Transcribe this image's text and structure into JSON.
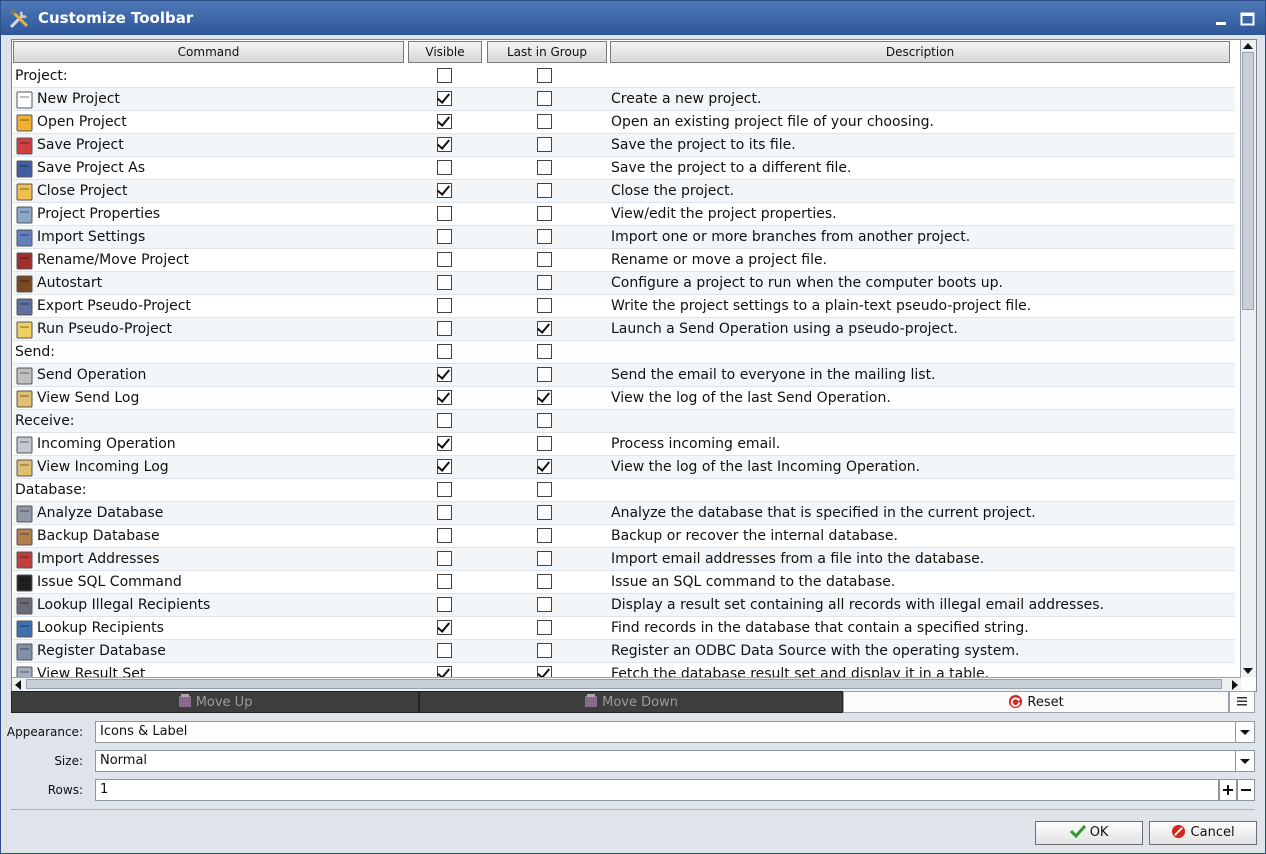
{
  "window": {
    "title": "Customize Toolbar"
  },
  "columns": {
    "command": "Command",
    "visible": "Visible",
    "last_in_group": "Last in Group",
    "description": "Description"
  },
  "rows": [
    {
      "type": "group",
      "label": "Project:",
      "visible": false,
      "last": false,
      "desc": ""
    },
    {
      "type": "item",
      "icon": "new-project-icon",
      "label": "New Project",
      "visible": true,
      "last": false,
      "desc": "Create a new project."
    },
    {
      "type": "item",
      "icon": "open-project-icon",
      "label": "Open Project",
      "visible": true,
      "last": false,
      "desc": "Open an existing project file of your choosing."
    },
    {
      "type": "item",
      "icon": "save-project-icon",
      "label": "Save Project",
      "visible": true,
      "last": false,
      "desc": "Save the project to its file."
    },
    {
      "type": "item",
      "icon": "save-project-as-icon",
      "label": "Save Project As",
      "visible": false,
      "last": false,
      "desc": "Save the project to a different file."
    },
    {
      "type": "item",
      "icon": "close-project-icon",
      "label": "Close Project",
      "visible": true,
      "last": false,
      "desc": "Close the project."
    },
    {
      "type": "item",
      "icon": "project-properties-icon",
      "label": "Project Properties",
      "visible": false,
      "last": false,
      "desc": "View/edit the project properties."
    },
    {
      "type": "item",
      "icon": "import-settings-icon",
      "label": "Import Settings",
      "visible": false,
      "last": false,
      "desc": "Import one or more branches from another project."
    },
    {
      "type": "item",
      "icon": "rename-move-project-icon",
      "label": "Rename/Move Project",
      "visible": false,
      "last": false,
      "desc": "Rename or move a project file."
    },
    {
      "type": "item",
      "icon": "autostart-boot-icon",
      "label": "Autostart",
      "visible": false,
      "last": false,
      "desc": "Configure a project to run when the computer boots up."
    },
    {
      "type": "item",
      "icon": "export-pseudo-project-icon",
      "label": "Export Pseudo-Project",
      "visible": false,
      "last": false,
      "desc": "Write the project settings to a plain-text pseudo-project file."
    },
    {
      "type": "item",
      "icon": "run-pseudo-project-icon",
      "label": "Run Pseudo-Project",
      "visible": false,
      "last": true,
      "desc": "Launch a Send Operation using a pseudo-project."
    },
    {
      "type": "group",
      "label": "Send:",
      "visible": false,
      "last": false,
      "desc": ""
    },
    {
      "type": "item",
      "icon": "send-operation-icon",
      "label": "Send Operation",
      "visible": true,
      "last": false,
      "desc": "Send the email to everyone in the mailing list."
    },
    {
      "type": "item",
      "icon": "view-send-log-icon",
      "label": "View Send Log",
      "visible": true,
      "last": true,
      "desc": "View the log of the last Send Operation."
    },
    {
      "type": "group",
      "label": "Receive:",
      "visible": false,
      "last": false,
      "desc": ""
    },
    {
      "type": "item",
      "icon": "incoming-operation-icon",
      "label": "Incoming Operation",
      "visible": true,
      "last": false,
      "desc": "Process incoming email."
    },
    {
      "type": "item",
      "icon": "view-incoming-log-icon",
      "label": "View Incoming Log",
      "visible": true,
      "last": true,
      "desc": "View the log of the last Incoming Operation."
    },
    {
      "type": "group",
      "label": "Database:",
      "visible": false,
      "last": false,
      "desc": ""
    },
    {
      "type": "item",
      "icon": "analyze-database-icon",
      "label": "Analyze Database",
      "visible": false,
      "last": false,
      "desc": "Analyze the database that is specified in the current project."
    },
    {
      "type": "item",
      "icon": "backup-database-icon",
      "label": "Backup Database",
      "visible": false,
      "last": false,
      "desc": "Backup or recover the internal database."
    },
    {
      "type": "item",
      "icon": "import-addresses-icon",
      "label": "Import Addresses",
      "visible": false,
      "last": false,
      "desc": "Import email addresses from a file into the database."
    },
    {
      "type": "item",
      "icon": "sql-command-icon",
      "label": "Issue SQL Command",
      "visible": false,
      "last": false,
      "desc": "Issue an SQL command to the database."
    },
    {
      "type": "item",
      "icon": "lookup-illegal-recipients-icon",
      "label": "Lookup Illegal Recipients",
      "visible": false,
      "last": false,
      "desc": "Display a result set containing all records with illegal email addresses."
    },
    {
      "type": "item",
      "icon": "lookup-recipients-icon",
      "label": "Lookup Recipients",
      "visible": true,
      "last": false,
      "desc": "Find records in the database that contain a specified string."
    },
    {
      "type": "item",
      "icon": "register-database-icon",
      "label": "Register Database",
      "visible": false,
      "last": false,
      "desc": "Register an ODBC Data Source with the operating system."
    },
    {
      "type": "item",
      "icon": "view-result-set-icon",
      "label": "View Result Set",
      "visible": true,
      "last": true,
      "desc": "Fetch the database result set and display it in a table."
    }
  ],
  "buttons": {
    "move_up": "Move Up",
    "move_down": "Move Down",
    "reset": "Reset",
    "ok": "OK",
    "cancel": "Cancel"
  },
  "fields": {
    "appearance": {
      "label": "Appearance:",
      "value": "Icons & Label"
    },
    "size": {
      "label": "Size:",
      "value": "Normal"
    },
    "rows": {
      "label": "Rows:",
      "value": "1"
    }
  }
}
